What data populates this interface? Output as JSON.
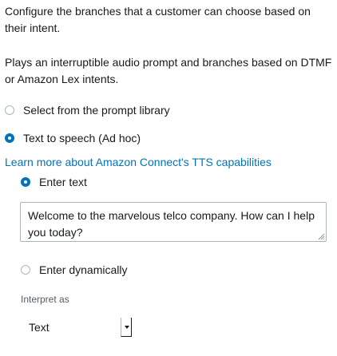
{
  "description": {
    "line1": "Configure the branches that a customer can choose based on their intent.",
    "line2": "Plays an interruptible audio prompt and branches based on DTMF or Amazon Lex intents."
  },
  "prompt_source": {
    "option_library": "Select from the prompt library",
    "option_tts": "Text to speech (Ad hoc)",
    "selected": "Text to speech (Ad hoc)"
  },
  "learn_more_link": "Learn more about Amazon Connect's TTS capabilities",
  "tts_input": {
    "option_enter_text": "Enter text",
    "option_enter_dynamically": "Enter dynamically",
    "selected": "Enter text",
    "text_value": "Welcome to the marvelous telco company. How can I help you today?"
  },
  "interpret_as": {
    "label": "Interpret as",
    "value": "Text"
  },
  "colors": {
    "accent": "#0073bb",
    "text": "#16191f",
    "border": "#aab7b8",
    "secondary_text": "#545b64"
  }
}
